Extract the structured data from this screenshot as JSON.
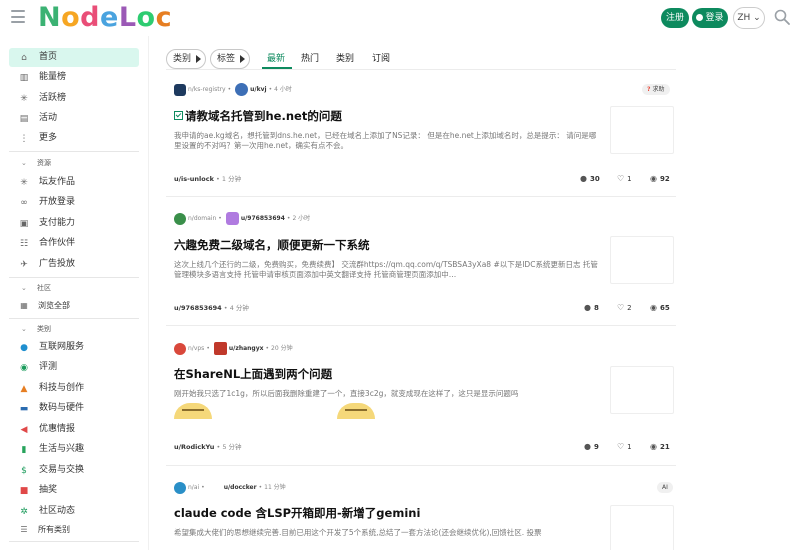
{
  "header": {
    "logo_text": "NodeLoc",
    "register_label": "注册",
    "login_label": "登录",
    "lang_label": "ZH"
  },
  "sidebar": {
    "main": [
      {
        "label": "首页",
        "icon": "home-icon"
      },
      {
        "label": "能量榜",
        "icon": "chart-icon"
      },
      {
        "label": "活跃榜",
        "icon": "sparkle-icon"
      },
      {
        "label": "活动",
        "icon": "calendar-icon"
      },
      {
        "label": "更多",
        "icon": "more-icon"
      }
    ],
    "resources_title": "资源",
    "resources": [
      {
        "label": "坛友作品",
        "icon": "sparkle-icon"
      },
      {
        "label": "开放登录",
        "icon": "link-icon"
      },
      {
        "label": "支付能力",
        "icon": "wallet-icon"
      },
      {
        "label": "合作伙伴",
        "icon": "handshake-icon"
      },
      {
        "label": "广告投放",
        "icon": "megaphone-icon"
      }
    ],
    "community_title": "社区",
    "community": [
      {
        "label": "浏览全部",
        "icon": "grid-icon"
      }
    ],
    "categories_title": "类别",
    "categories": [
      {
        "label": "互联网服务",
        "icon": "globe-icon",
        "color": "#1f8fcf"
      },
      {
        "label": "评测",
        "icon": "eye-icon",
        "color": "#1a9b5b"
      },
      {
        "label": "科技与创作",
        "icon": "rocket-icon",
        "color": "#e67e22"
      },
      {
        "label": "数码与硬件",
        "icon": "monitor-icon",
        "color": "#2b6cb0"
      },
      {
        "label": "优惠情报",
        "icon": "megaphone-icon",
        "color": "#e04848"
      },
      {
        "label": "生活与兴趣",
        "icon": "building-icon",
        "color": "#27a35c"
      },
      {
        "label": "交易与交换",
        "icon": "dollar-icon",
        "color": "#1a9b5b"
      },
      {
        "label": "抽奖",
        "icon": "gift-icon",
        "color": "#e04848"
      },
      {
        "label": "社区动态",
        "icon": "network-icon",
        "color": "#1a9b5b"
      },
      {
        "label": "所有类别",
        "icon": "list-icon",
        "color": "#555555"
      }
    ]
  },
  "nav": {
    "category_pill": "类别",
    "tag_pill": "标签",
    "tabs": [
      "最新",
      "热门",
      "类别",
      "订阅"
    ],
    "active_tab": "最新"
  },
  "posts": [
    {
      "category": "n/ks-registry",
      "category_color": "#1e3a5f",
      "author": "u/kvj",
      "time": "4 小时",
      "badge": "求助",
      "title": "请教域名托管到he.net的问题",
      "solved": true,
      "excerpt": "我申请的ae.kg域名，想托管到dns.he.net，已经在域名上添加了NS记录： 但是在he.net上添加域名时，总是提示： 请问是哪里设置的不对吗？第一次用he.net，确实有点不会。",
      "last_user": "u/is-unlock",
      "last_time": "1 分钟",
      "replies": "30",
      "likes": "1",
      "views": "92"
    },
    {
      "category": "n/domain",
      "category_color": "#3a8f4a",
      "author": "u/976853694",
      "time": "2 小时",
      "badge": "",
      "title": "六趣免费二级域名，顺便更新一下系统",
      "solved": false,
      "excerpt": "这次上线几个还行的二级，免费购买，免费续费】 交流群https://qm.qq.com/q/TSBSA3yXa8 #以下是IDC系统更新日志 托管管理模块多语言支持 托管申请审核页面添加中英文翻译支持 托管商管理页面添加中…",
      "last_user": "u/976853694",
      "last_time": "4 分钟",
      "replies": "8",
      "likes": "2",
      "views": "65"
    },
    {
      "category": "n/vps",
      "category_color": "#d9483b",
      "author": "u/zhangyx",
      "time": "20 分钟",
      "badge": "",
      "title": "在ShareNL上面遇到两个问题",
      "solved": false,
      "excerpt": "刚开始我只选了1c1g，所以后面我删除重建了一个，直接3c2g，就变成现在这样了，这只是显示问题吗",
      "last_user": "u/RodickYu",
      "last_time": "5 分钟",
      "replies": "9",
      "likes": "1",
      "views": "21"
    },
    {
      "category": "n/ai",
      "category_color": "#2a8fc7",
      "author": "u/doccker",
      "time": "11 分钟",
      "badge": "AI",
      "title": "claude code 含LSP开箱即用-新增了gemini",
      "solved": false,
      "excerpt": "希望集成大佬们的思想继续完善.目前已用这个开发了5个系统,总结了一套方法论(还会继续优化),回馈社区. 投票",
      "last_user": "",
      "last_time": "",
      "replies": "",
      "likes": "",
      "views": ""
    }
  ]
}
